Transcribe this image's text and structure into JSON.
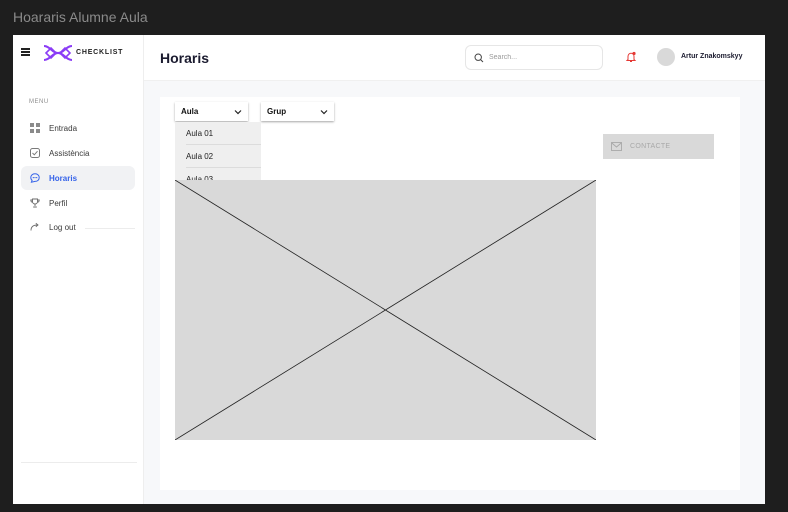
{
  "frame": {
    "title": "Hoararis Alumne Aula"
  },
  "brand": {
    "name": "CHECKLIST",
    "logo_icon": "checklist-logo",
    "accent": "#8b3cf6"
  },
  "sidebar": {
    "menu_label": "MENU",
    "items": [
      {
        "label": "Entrada",
        "icon": "grid-icon",
        "active": false
      },
      {
        "label": "Assistència",
        "icon": "checkbox-icon",
        "active": false
      },
      {
        "label": "Horaris",
        "icon": "chat-icon",
        "active": true
      },
      {
        "label": "Perfil",
        "icon": "trophy-icon",
        "active": false
      },
      {
        "label": "Log out",
        "icon": "logout-icon",
        "active": false
      }
    ]
  },
  "header": {
    "title": "Horaris",
    "search_placeholder": "Search...",
    "user_name": "Artur Znakomskyy",
    "notification_color": "#e53935"
  },
  "content": {
    "select_aula": {
      "label": "Aula",
      "options": [
        "Aula 01",
        "Aula 02",
        "Aula 03"
      ]
    },
    "select_grup": {
      "label": "Grup"
    },
    "contact_label": "CONTACTE"
  },
  "colors": {
    "active_nav": "#3563e9",
    "placeholder": "#d9d9d9"
  }
}
